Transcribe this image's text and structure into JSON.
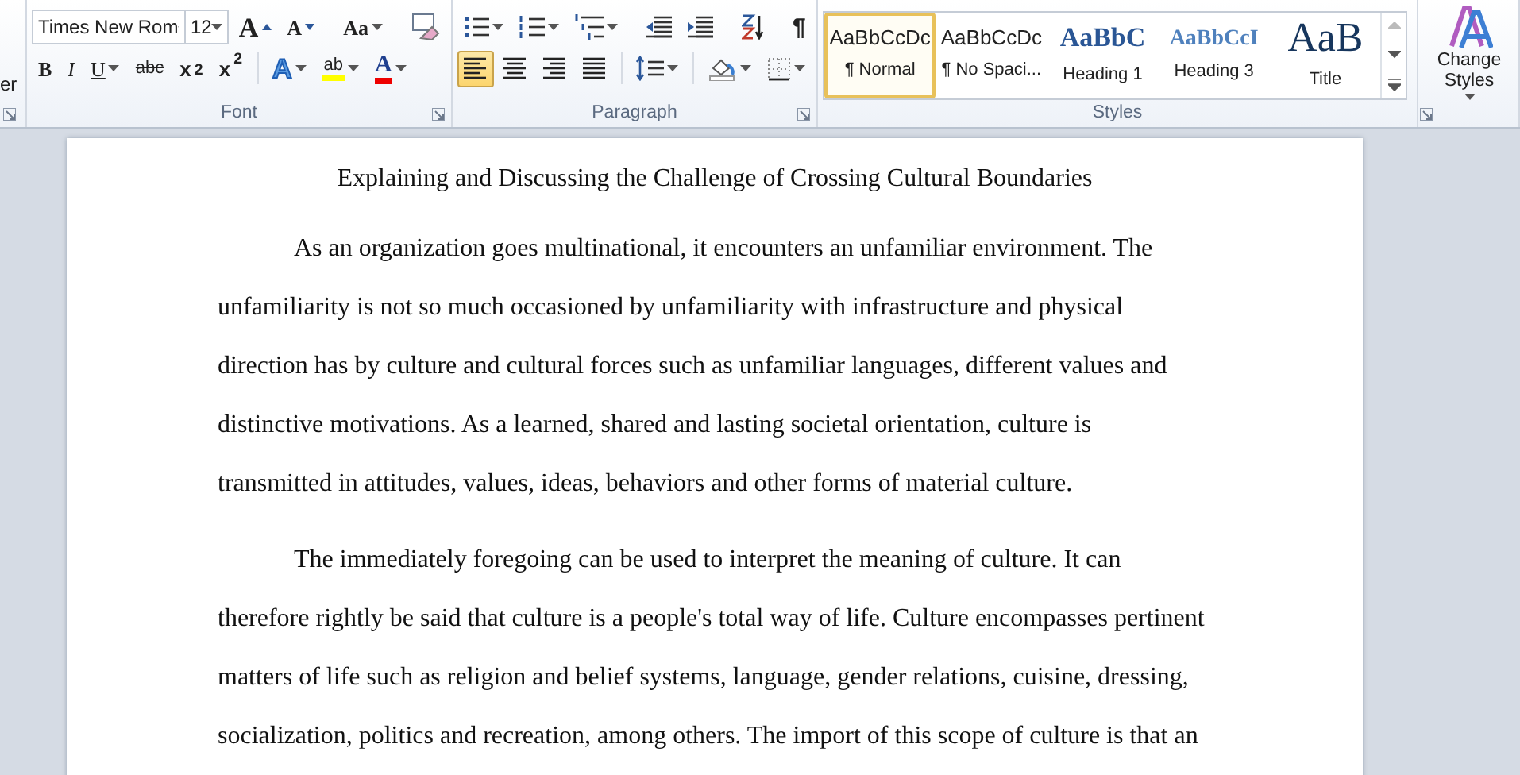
{
  "clipboard": {
    "label_fragment": "er"
  },
  "font_group": {
    "label": "Font",
    "font_name": "Times New Rom",
    "font_size": "12",
    "row1": [
      {
        "kind": "grow",
        "label": "A"
      },
      {
        "kind": "shrink",
        "label": "A"
      },
      {
        "kind": "case",
        "label": "Aa"
      },
      {
        "kind": "clear"
      }
    ],
    "row2": [
      {
        "kind": "bold",
        "label": "B"
      },
      {
        "kind": "italic",
        "label": "I"
      },
      {
        "kind": "underline",
        "label": "U"
      },
      {
        "kind": "strike",
        "label": "abc"
      },
      {
        "kind": "sub",
        "label": "x$_{2}$"
      },
      {
        "kind": "sup",
        "label": "x$^{2}$"
      },
      {
        "kind": "effects",
        "label": "A"
      },
      {
        "kind": "highlight",
        "label": "ab"
      },
      {
        "kind": "color",
        "label": "A"
      }
    ]
  },
  "paragraph_group": {
    "label": "Paragraph",
    "show_marks": "¶",
    "alignment": [
      {
        "kind": "left",
        "selected": true
      },
      {
        "kind": "center",
        "selected": false
      },
      {
        "kind": "right",
        "selected": false
      },
      {
        "kind": "justify",
        "selected": false
      }
    ]
  },
  "styles_group": {
    "label": "Styles",
    "change_styles": "Change Styles",
    "gallery": [
      {
        "kind": "normal",
        "preview": "AaBbCcDc",
        "name": "¶ Normal",
        "selected": true
      },
      {
        "kind": "normal",
        "preview": "AaBbCcDc",
        "name": "¶ No Spaci...",
        "selected": false
      },
      {
        "kind": "heading1",
        "preview": "AaBbC",
        "name": "Heading 1",
        "selected": false
      },
      {
        "kind": "heading3",
        "preview": "AaBbCcI",
        "name": "Heading 3",
        "selected": false
      },
      {
        "kind": "title",
        "preview": "AaB",
        "name": "Title",
        "selected": false
      }
    ]
  },
  "document": {
    "title": "Explaining and Discussing the Challenge of Crossing Cultural Boundaries",
    "paragraphs": [
      [
        "As an organization goes multinational, it encounters an unfamiliar environment. The",
        "unfamiliarity is not so much occasioned by unfamiliarity with infrastructure and physical",
        "direction has by culture and cultural forces such as unfamiliar languages, different values and",
        "distinctive motivations. As a learned, shared and lasting societal orientation, culture is",
        "transmitted in attitudes, values, ideas, behaviors and other forms of material  culture."
      ],
      [
        "The immediately foregoing can be used to interpret the meaning of culture. It can",
        "therefore rightly be said that culture is a people's total way of life. Culture encompasses pertinent",
        "matters of life such as religion and belief systems, language, gender relations, cuisine, dressing,",
        "socialization, politics and recreation, among others. The import of this scope of culture is that an"
      ]
    ]
  }
}
